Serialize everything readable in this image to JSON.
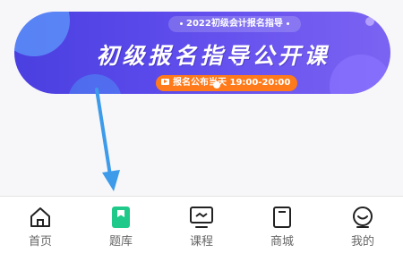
{
  "banner": {
    "tag": "2022初级会计报名指导",
    "title": "初级报名指导公开课",
    "pill": "报名公布当天 19:00-20:00",
    "colors": {
      "start": "#4a3fe0",
      "end": "#7b63f2",
      "pill": "#ff7a1a"
    }
  },
  "annotation": {
    "type": "arrow",
    "color": "#3d9be9",
    "points_to": "tab-question-bank"
  },
  "tabbar": {
    "tabs": [
      {
        "label": "首页",
        "icon": "home-icon",
        "active": false
      },
      {
        "label": "题库",
        "icon": "question-bank-icon",
        "active": false,
        "accent": "#1fc98a"
      },
      {
        "label": "课程",
        "icon": "course-icon",
        "active": false
      },
      {
        "label": "商城",
        "icon": "mall-icon",
        "active": false
      },
      {
        "label": "我的",
        "icon": "profile-icon",
        "active": false
      }
    ]
  }
}
